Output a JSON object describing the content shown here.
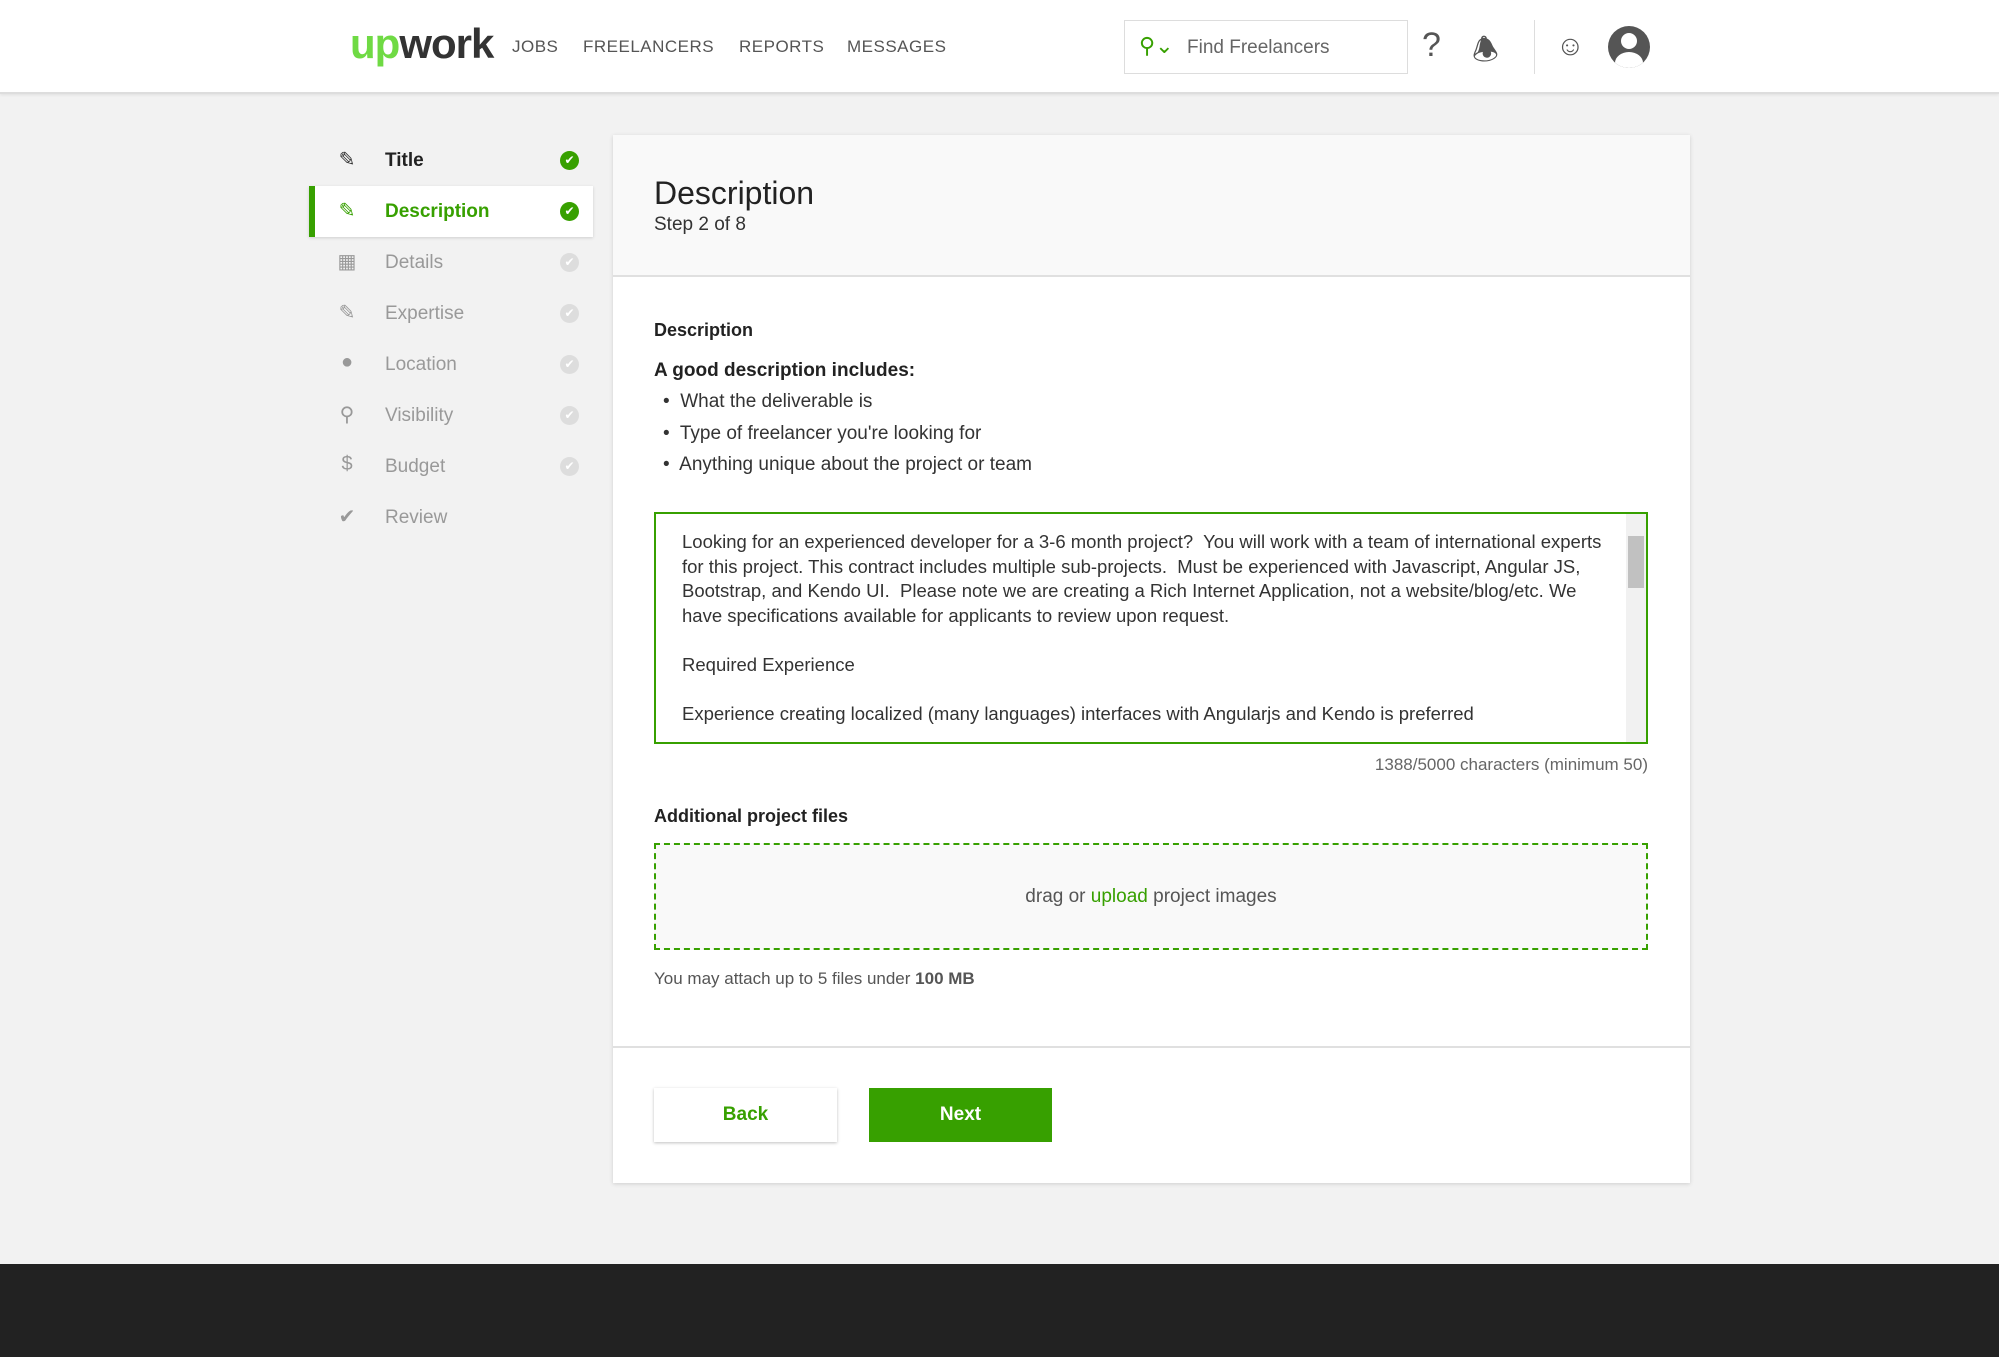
{
  "header": {
    "logo": "upwork",
    "nav": [
      "JOBS",
      "FREELANCERS",
      "REPORTS",
      "MESSAGES"
    ],
    "search_placeholder": "Find Freelancers",
    "icons": [
      "search-icon",
      "help-icon",
      "bell-icon",
      "add-user-icon",
      "avatar-icon"
    ]
  },
  "sidebar": {
    "items": [
      {
        "label": "Title",
        "icon": "pencil-icon",
        "done": true
      },
      {
        "label": "Description",
        "icon": "edit-icon",
        "done": true,
        "active": true
      },
      {
        "label": "Details",
        "icon": "list-icon",
        "done": false
      },
      {
        "label": "Expertise",
        "icon": "tools-icon",
        "done": false
      },
      {
        "label": "Location",
        "icon": "pin-icon",
        "done": false
      },
      {
        "label": "Visibility",
        "icon": "visibility-icon",
        "done": false
      },
      {
        "label": "Budget",
        "icon": "dollar-icon",
        "done": false
      },
      {
        "label": "Review",
        "icon": "check-icon",
        "done": false
      }
    ]
  },
  "main": {
    "title": "Description",
    "step": "Step 2 of 8",
    "section_label": "Description",
    "tips_heading": "A good description includes:",
    "tips": [
      "What the deliverable is",
      "Type of freelancer you're looking for",
      "Anything unique about the project or team"
    ],
    "description_value": "Looking for an experienced developer for a 3-6 month project?  You will work with a team of international experts for this project. This contract includes multiple sub-projects.  Must be experienced with Javascript, Angular JS, Bootstrap, and Kendo UI.  Please note we are creating a Rich Internet Application, not a website/blog/etc. We have specifications available for applicants to review upon request.\n\nRequired Experience\n\nExperience creating localized (many languages) interfaces with Angularjs and Kendo is preferred",
    "char_count": "1388/5000 characters (minimum 50)",
    "files_label": "Additional project files",
    "drop_pre": "drag or ",
    "drop_link": "upload",
    "drop_post": " project images",
    "hint_pre": "You may attach up to 5 files under ",
    "hint_bold": "100 MB",
    "back_label": "Back",
    "next_label": "Next"
  },
  "colors": {
    "accent": "#37a000",
    "logo_green": "#6fda44",
    "footer": "#222222"
  }
}
